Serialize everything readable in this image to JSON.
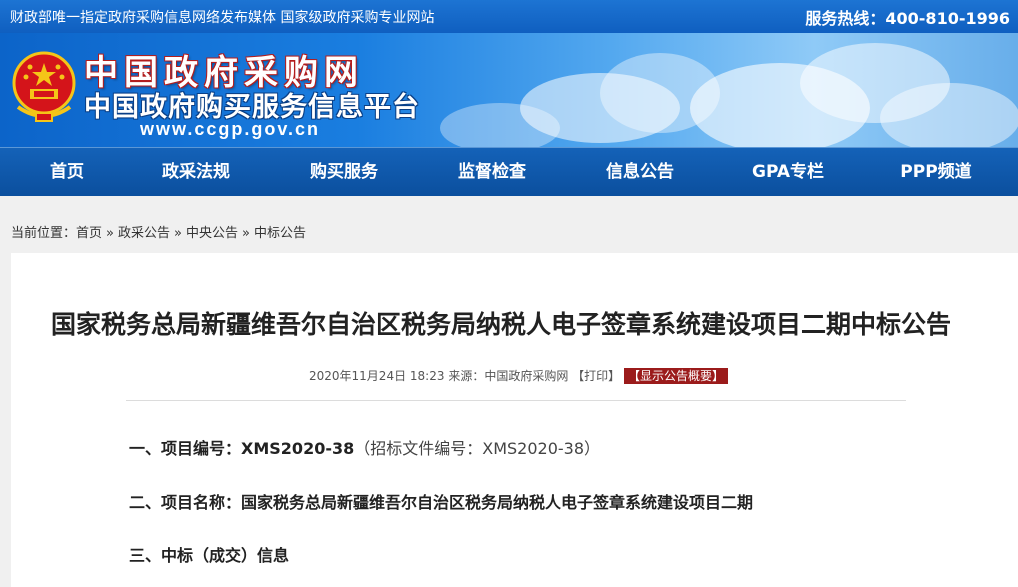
{
  "topbar": {
    "left_text": "财政部唯一指定政府采购信息网络发布媒体 国家级政府采购专业网站",
    "hotline_label": "服务热线：",
    "hotline_number": "400-810-1996"
  },
  "header": {
    "title_cn": "中国政府采购网",
    "subtitle_cn": "中国政府购买服务信息平台",
    "url": "www.ccgp.gov.cn"
  },
  "nav": {
    "items": [
      "首页",
      "政采法规",
      "购买服务",
      "监督检查",
      "信息公告",
      "GPA专栏",
      "PPP频道"
    ]
  },
  "breadcrumb": {
    "prefix": "当前位置：",
    "items": [
      "首页",
      "政采公告",
      "中央公告",
      "中标公告"
    ],
    "separator": "»"
  },
  "article": {
    "title": "国家税务总局新疆维吾尔自治区税务局纳税人电子签章系统建设项目二期中标公告",
    "date": "2020年11月24日 18:23",
    "source_label": "来源：",
    "source": "中国政府采购网",
    "print": "【打印】",
    "summary": "【显示公告概要】",
    "sec1_label": "一、项目编号：",
    "sec1_value": "XMS2020-38",
    "sec1_extra": "（招标文件编号：XMS2020-38）",
    "sec2_label": "二、项目名称：",
    "sec2_value": "国家税务总局新疆维吾尔自治区税务局纳税人电子签章系统建设项目二期",
    "sec3_label": "三、中标（成交）信息"
  },
  "colors": {
    "nav_bg": "#0b4f9e",
    "topbar_bg": "#1d74d3",
    "summary_bg": "#9b1b1b"
  }
}
